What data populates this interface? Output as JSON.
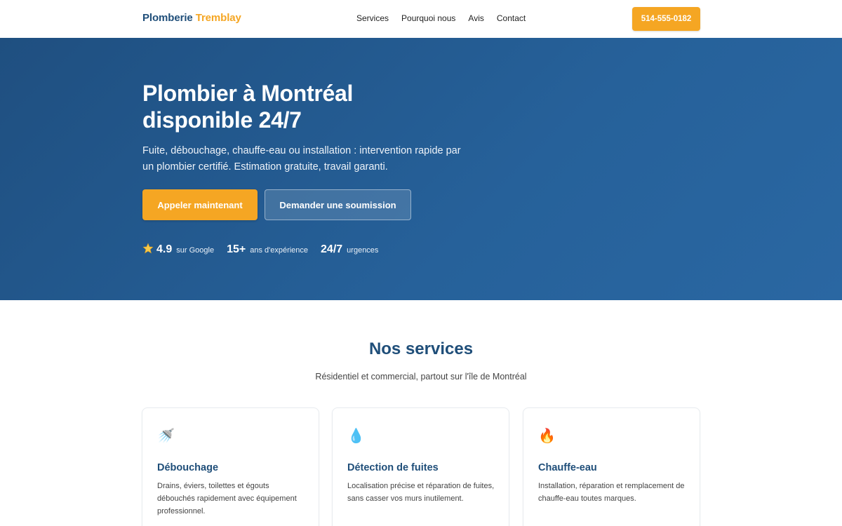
{
  "header": {
    "logo_part1": "Plomberie",
    "logo_part2": "Tremblay",
    "nav": [
      "Services",
      "Pourquoi nous",
      "Avis",
      "Contact"
    ],
    "phone": "514-555-0182"
  },
  "hero": {
    "title": "Plombier à Montréal disponible 24/7",
    "lead": "Fuite, débouchage, chauffe-eau ou installation : intervention rapide par un plombier certifié. Estimation gratuite, travail garanti.",
    "cta_primary": "Appeler maintenant",
    "cta_secondary": "Demander une soumission",
    "stats": [
      {
        "num": "4.9",
        "label": "sur Google",
        "icon": "star-icon"
      },
      {
        "num": "15+",
        "label": "ans d'expérience"
      },
      {
        "num": "24/7",
        "label": "urgences"
      }
    ]
  },
  "services": {
    "title": "Nos services",
    "subtitle": "Résidentiel et commercial, partout sur l'île de Montréal",
    "cards": [
      {
        "icon": "shower-icon",
        "glyph": "🚿",
        "title": "Débouchage",
        "text": "Drains, éviers, toilettes et égouts débouchés rapidement avec équipement professionnel."
      },
      {
        "icon": "water-drop-icon",
        "glyph": "💧",
        "title": "Détection de fuites",
        "text": "Localisation précise et réparation de fuites, sans casser vos murs inutilement."
      },
      {
        "icon": "fire-icon",
        "glyph": "🔥",
        "title": "Chauffe-eau",
        "text": "Installation, réparation et remplacement de chauffe-eau toutes marques."
      }
    ]
  },
  "colors": {
    "brand_blue": "#1f4e79",
    "accent_orange": "#f5a623",
    "hero_bg": "#26619a"
  }
}
